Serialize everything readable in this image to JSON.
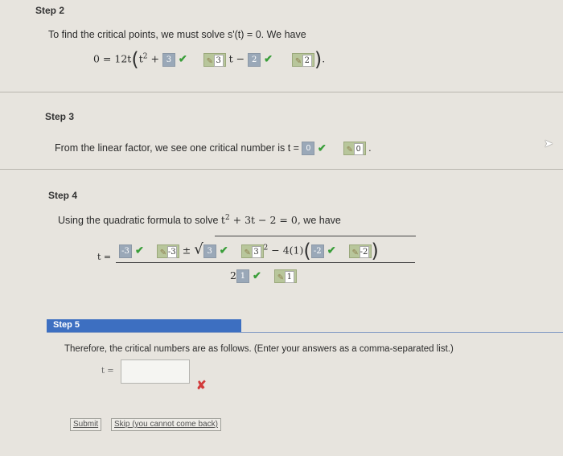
{
  "step2": {
    "title": "Step 2",
    "intro": "To find the critical points, we must solve s'(t) = 0. We have",
    "eq_prefix": "0 = 12t",
    "t_squared": "t",
    "sq": "2",
    "plus": "+",
    "ans1": "3",
    "key1": "3",
    "t_minus": "t −",
    "ans2": "2",
    "key2": "2"
  },
  "step3": {
    "title": "Step 3",
    "text": "From the linear factor, we see one critical number is t =",
    "ans": "0",
    "key": "0",
    "period": "."
  },
  "step4": {
    "title": "Step 4",
    "text_a": "Using the quadratic formula to solve",
    "eq": "t",
    "sq": "2",
    "eq_rest": "+ 3t − 2 = 0,",
    "text_b": "we have",
    "t_eq": "t =",
    "ans_a": "-3",
    "key_a": "-3",
    "pm": "±",
    "ans_b": "3",
    "key_b": "3",
    "sup2": "2",
    "minus_4": "− 4(1)",
    "ans_c": "-2",
    "key_c": "-2",
    "denom_2": "2",
    "ans_d": "1",
    "key_d": "1"
  },
  "step5": {
    "title": "Step 5",
    "text": "Therefore, the critical numbers are as follows. (Enter your answers as a comma-separated list.)",
    "t_label": "t =",
    "input_value": "",
    "submit_label": "Submit",
    "skip_label": "Skip (you cannot come back)"
  },
  "colors": {
    "step5_bar": "#3d6fc1",
    "check": "#3a9e3a",
    "cross": "#d23b3b"
  }
}
